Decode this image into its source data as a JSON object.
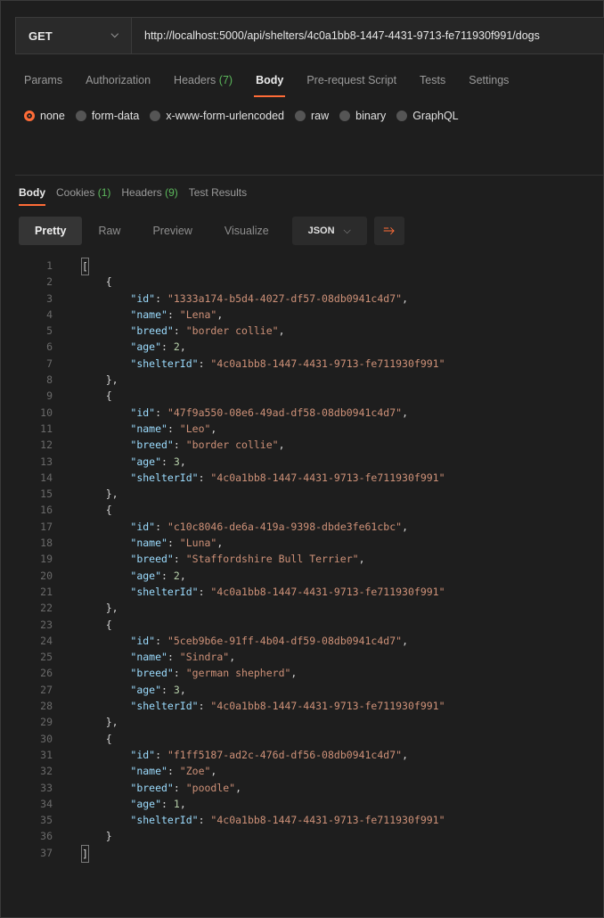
{
  "request": {
    "method": "GET",
    "url": "http://localhost:5000/api/shelters/4c0a1bb8-1447-4431-9713-fe711930f991/dogs"
  },
  "request_tabs": [
    {
      "label": "Params",
      "count": null,
      "active": false
    },
    {
      "label": "Authorization",
      "count": null,
      "active": false
    },
    {
      "label": "Headers",
      "count": "(7)",
      "active": false
    },
    {
      "label": "Body",
      "count": null,
      "active": true
    },
    {
      "label": "Pre-request Script",
      "count": null,
      "active": false
    },
    {
      "label": "Tests",
      "count": null,
      "active": false
    },
    {
      "label": "Settings",
      "count": null,
      "active": false
    }
  ],
  "body_types": [
    {
      "label": "none",
      "active": true
    },
    {
      "label": "form-data",
      "active": false
    },
    {
      "label": "x-www-form-urlencoded",
      "active": false
    },
    {
      "label": "raw",
      "active": false
    },
    {
      "label": "binary",
      "active": false
    },
    {
      "label": "GraphQL",
      "active": false
    }
  ],
  "response_tabs": [
    {
      "label": "Body",
      "count": null,
      "active": true
    },
    {
      "label": "Cookies",
      "count": "(1)",
      "active": false
    },
    {
      "label": "Headers",
      "count": "(9)",
      "active": false
    },
    {
      "label": "Test Results",
      "count": null,
      "active": false
    }
  ],
  "view_modes": [
    {
      "label": "Pretty",
      "active": true
    },
    {
      "label": "Raw",
      "active": false
    },
    {
      "label": "Preview",
      "active": false
    },
    {
      "label": "Visualize",
      "active": false
    }
  ],
  "format": "JSON",
  "colors": {
    "accent": "#ff6c37",
    "count": "#5cb85c",
    "key": "#9cdcfe",
    "string": "#ce9178",
    "number": "#b5cea8"
  },
  "response_items": [
    {
      "id": "1333a174-b5d4-4027-df57-08db0941c4d7",
      "name": "Lena",
      "breed": "border collie",
      "age": 2,
      "shelterId": "4c0a1bb8-1447-4431-9713-fe711930f991"
    },
    {
      "id": "47f9a550-08e6-49ad-df58-08db0941c4d7",
      "name": "Leo",
      "breed": "border collie",
      "age": 3,
      "shelterId": "4c0a1bb8-1447-4431-9713-fe711930f991"
    },
    {
      "id": "c10c8046-de6a-419a-9398-dbde3fe61cbc",
      "name": "Luna",
      "breed": "Staffordshire Bull Terrier",
      "age": 2,
      "shelterId": "4c0a1bb8-1447-4431-9713-fe711930f991"
    },
    {
      "id": "5ceb9b6e-91ff-4b04-df59-08db0941c4d7",
      "name": "Sindra",
      "breed": "german shepherd",
      "age": 3,
      "shelterId": "4c0a1bb8-1447-4431-9713-fe711930f991"
    },
    {
      "id": "f1ff5187-ad2c-476d-df56-08db0941c4d7",
      "name": "Zoe",
      "breed": "poodle",
      "age": 1,
      "shelterId": "4c0a1bb8-1447-4431-9713-fe711930f991"
    }
  ]
}
